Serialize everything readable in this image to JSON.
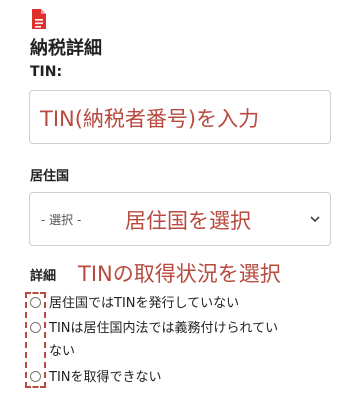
{
  "icons": {
    "document": "document-icon",
    "chevron": "chevron-down-icon"
  },
  "colors": {
    "accent": "#b84a3f",
    "doc_icon": "#e0302b"
  },
  "section_title": "納税詳細",
  "tin": {
    "label": "TIN:",
    "hint": "TIN(納税者番号)を入力"
  },
  "residence": {
    "label": "居住国",
    "placeholder": "- 選択 -",
    "hint": "居住国を選択"
  },
  "details": {
    "label": "詳細",
    "hint": "TINの取得状況を選択",
    "options": [
      {
        "label": "居住国ではTINを発行していない"
      },
      {
        "label_line1": "TINは居住国内法では義務付けられてい",
        "label_line2": "ない"
      },
      {
        "label": "TINを取得できない"
      }
    ]
  }
}
